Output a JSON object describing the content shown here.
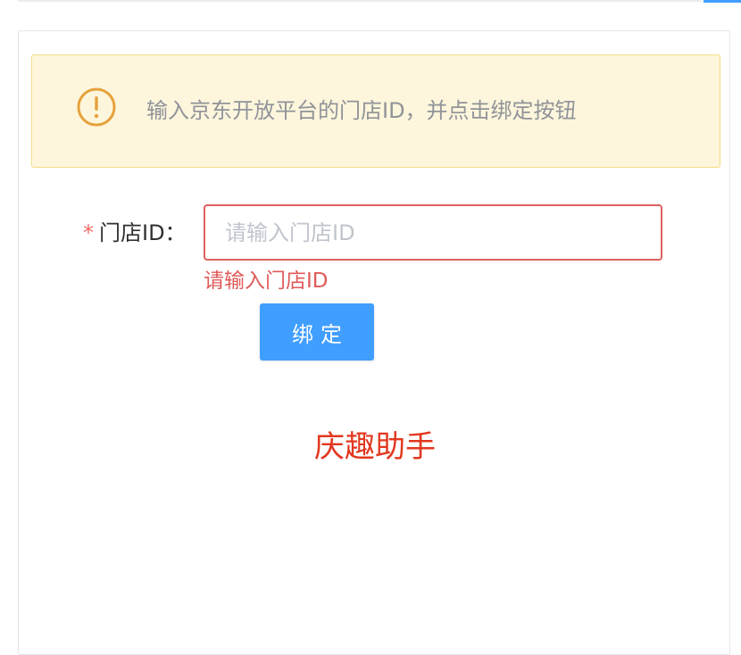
{
  "alert": {
    "icon": "warning-circle-icon",
    "message": "输入京东开放平台的门店ID，并点击绑定按钮",
    "icon_color": "#e6a23c"
  },
  "form": {
    "required_mark": "*",
    "store_id_label": "门店ID：",
    "store_id_value": "",
    "store_id_placeholder": "请输入门店ID",
    "store_id_error": "请输入门店ID",
    "bind_label": "绑定"
  },
  "brand": {
    "text": "庆趣助手"
  },
  "colors": {
    "primary": "#409eff",
    "error": "#f56c6c",
    "brand": "#e2371f"
  }
}
